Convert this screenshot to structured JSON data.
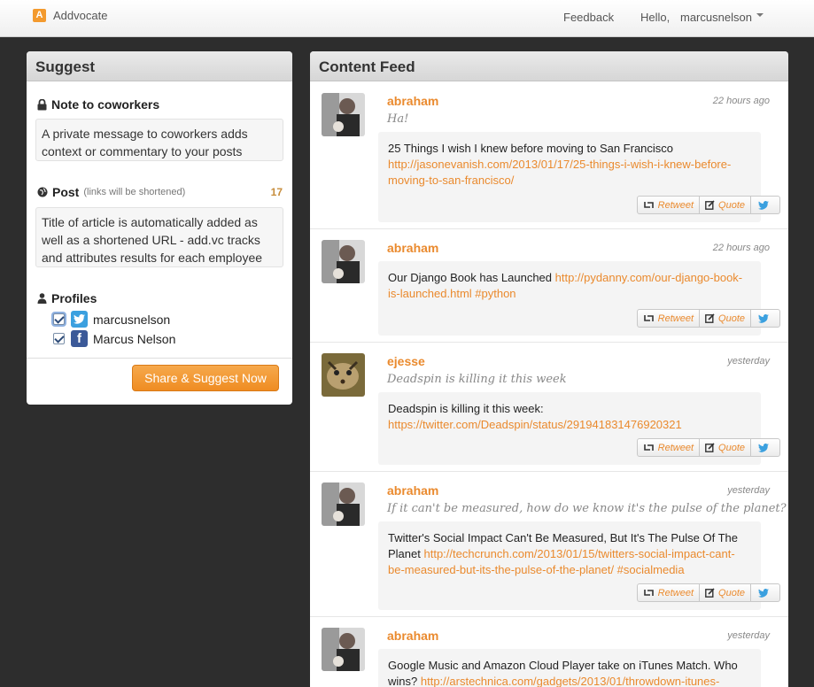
{
  "app": {
    "name": "Addvocate",
    "logo_letter": "A"
  },
  "nav": {
    "feedback": "Feedback",
    "hello": "Hello,",
    "username": "marcusnelson"
  },
  "suggest": {
    "title": "Suggest",
    "note_label": "Note to coworkers",
    "note_text": "A private message to coworkers adds context or commentary to your posts",
    "post_label": "Post",
    "post_hint": "(links will be shortened)",
    "post_count": "17",
    "post_text": "Title of article is automatically added as well as a shortened URL - add.vc tracks and attributes results for each employee",
    "profiles_label": "Profiles",
    "profiles": [
      {
        "service": "twitter-icon",
        "name": "marcusnelson",
        "checked": true
      },
      {
        "service": "facebook-icon",
        "name": "Marcus Nelson",
        "checked": true
      }
    ],
    "fb_letter": "f",
    "share_button": "Share & Suggest Now"
  },
  "feed": {
    "title": "Content Feed",
    "actions": {
      "retweet": "Retweet",
      "quote": "Quote"
    },
    "items": [
      {
        "author": "abraham",
        "time": "22 hours ago",
        "quote": "Ha!",
        "text": "25 Things I wish I knew before moving to San Francisco",
        "link": "http://jasonevanish.com/2013/01/17/25-things-i-wish-i-knew-before-moving-to-san-francisco/"
      },
      {
        "author": "abraham",
        "time": "22 hours ago",
        "quote": "",
        "text": "Our Django Book has Launched",
        "link": "http://pydanny.com/our-django-book-is-launched.html #python"
      },
      {
        "author": "ejesse",
        "time": "yesterday",
        "quote": "Deadspin is killing it this week",
        "text": "Deadspin is killing it this week:",
        "link": "https://twitter.com/Deadspin/status/291941831476920321"
      },
      {
        "author": "abraham",
        "time": "yesterday",
        "quote": "If it can't be measured, how do we know it's the pulse of the planet?",
        "text": "Twitter's Social Impact Can't Be Measured, But It's The Pulse Of The Planet",
        "link": "http://techcrunch.com/2013/01/15/twitters-social-impact-cant-be-measured-but-its-the-pulse-of-the-planet/ #socialmedia"
      },
      {
        "author": "abraham",
        "time": "yesterday",
        "quote": "",
        "text": "Google Music and Amazon Cloud Player take on iTunes Match. Who wins?",
        "link": "http://arstechnica.com/gadgets/2013/01/throwdown-itunes-"
      }
    ]
  },
  "colors": {
    "accent": "#ea8a2e",
    "background": "#2d2d2d",
    "twitter": "#3ba0df",
    "facebook": "#3b5998"
  }
}
